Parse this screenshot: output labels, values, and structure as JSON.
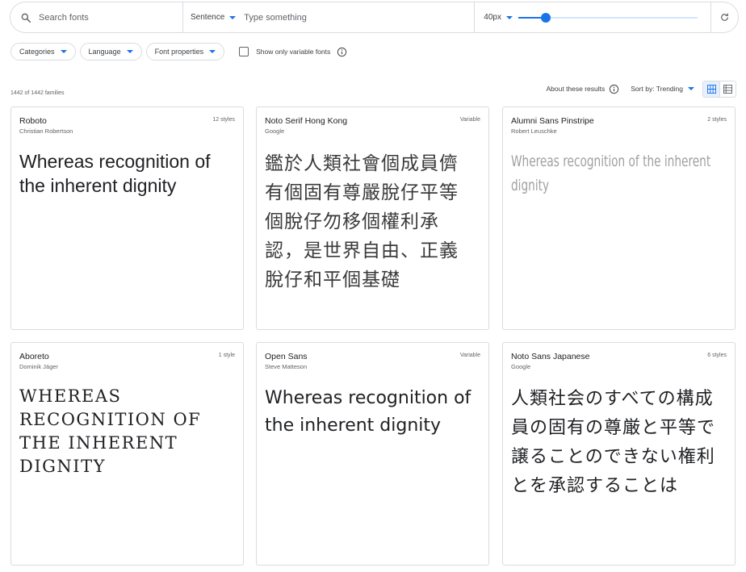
{
  "toolbar": {
    "search_placeholder": "Search fonts",
    "preview_mode": "Sentence",
    "preview_placeholder": "Type something",
    "font_size": "40px",
    "size_fraction": 0.15
  },
  "filters": {
    "chips": [
      "Categories",
      "Language",
      "Font properties"
    ],
    "variable_only_label": "Show only variable fonts",
    "variable_only_checked": false
  },
  "results": {
    "count": "1442 of 1442 families",
    "about": "About these results",
    "sort": "Sort by: Trending"
  },
  "fonts": [
    {
      "name": "Roboto",
      "author": "Christian Robertson",
      "styles": "12 styles",
      "sample": "Whereas recognition of the inherent dignity"
    },
    {
      "name": "Noto Serif Hong Kong",
      "author": "Google",
      "styles": "Variable",
      "sample": "鑑於人類社會個成員儕有個固有尊嚴脫仔平等個脫仔勿移個權利承認，是世界自由、正義脫仔和平個基礎"
    },
    {
      "name": "Alumni Sans Pinstripe",
      "author": "Robert Leuschke",
      "styles": "2 styles",
      "sample": "Whereas recognition of the inherent dignity"
    },
    {
      "name": "Aboreto",
      "author": "Dominik Jáger",
      "styles": "1 style",
      "sample": "Whereas recognition of the inherent dignity"
    },
    {
      "name": "Open Sans",
      "author": "Steve Matteson",
      "styles": "Variable",
      "sample": "Whereas recognition of the inherent dignity"
    },
    {
      "name": "Noto Sans Japanese",
      "author": "Google",
      "styles": "6 styles",
      "sample": "人類社会のすべての構成員の固有の尊厳と平等で譲ることのできない権利とを承認することは"
    }
  ],
  "colors": {
    "accent": "#1a73e8",
    "border": "#dadce0",
    "text": "#202124",
    "muted": "#5f6368"
  },
  "icons": {
    "search": "search-icon",
    "refresh": "refresh-icon",
    "info": "info-icon",
    "grid": "grid-view-icon",
    "list": "list-view-icon"
  }
}
